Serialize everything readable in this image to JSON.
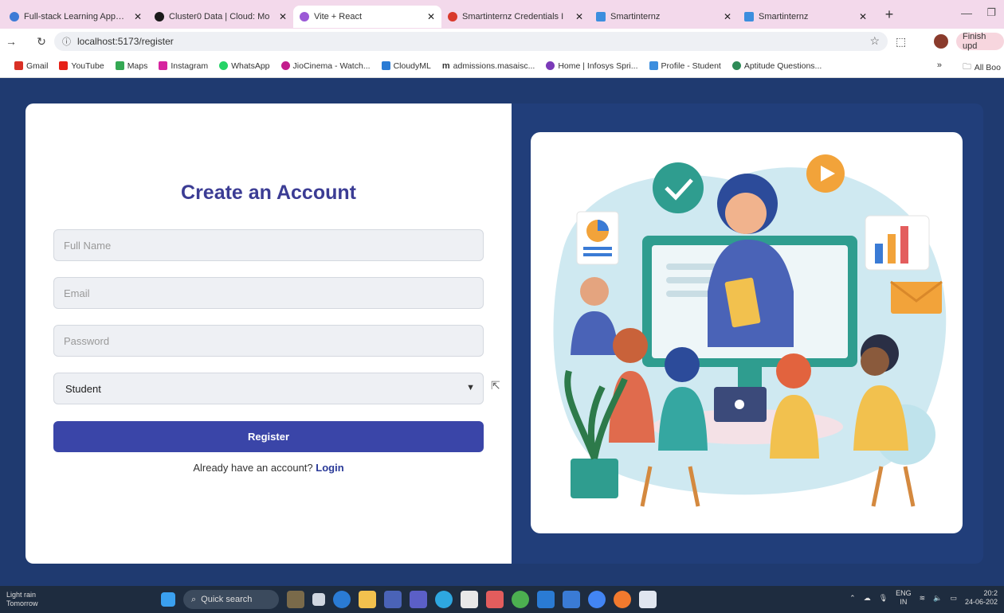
{
  "browser": {
    "tabs": [
      {
        "title": "Full-stack Learning App Sc",
        "color": "#3d7bd6"
      },
      {
        "title": "Cluster0 Data | Cloud: Mo",
        "color": "#1a1a1a"
      },
      {
        "title": "Vite + React",
        "color": "#9b59d6"
      },
      {
        "title": "Smartinternz Credentials I",
        "color": "#d93a2c"
      },
      {
        "title": "Smartinternz",
        "color": "#3c8ede"
      },
      {
        "title": "Smartinternz",
        "color": "#3c8ede"
      }
    ],
    "new_tab": "+",
    "url": "localhost:5173/register",
    "finish_update": "Finish upd",
    "bookmarks": [
      {
        "label": "Gmail",
        "color": "#d93025"
      },
      {
        "label": "YouTube",
        "color": "#e62117"
      },
      {
        "label": "Maps",
        "color": "#34a853"
      },
      {
        "label": "Instagram",
        "color": "#d6249f"
      },
      {
        "label": "WhatsApp",
        "color": "#25d366"
      },
      {
        "label": "JioCinema - Watch...",
        "color": "#c21c8c"
      },
      {
        "label": "CloudyML",
        "color": "#2a7bd4"
      },
      {
        "label": "admissions.masaisc...",
        "color": "#222"
      },
      {
        "label": "Home | Infosys Spri...",
        "color": "#7b3ab8"
      },
      {
        "label": "Profile - Student",
        "color": "#3c8ede"
      },
      {
        "label": "Aptitude Questions...",
        "color": "#2e8b57"
      }
    ],
    "bookmarks_more": "»",
    "all_bookmarks": "All Boo"
  },
  "form": {
    "heading": "Create an Account",
    "fullname_placeholder": "Full Name",
    "email_placeholder": "Email",
    "password_placeholder": "Password",
    "role_selected": "Student",
    "register_label": "Register",
    "login_prompt": "Already have an account?",
    "login_link": "Login"
  },
  "taskbar": {
    "weather_line1": "Light rain",
    "weather_line2": "Tomorrow",
    "search_label": "Quick search",
    "lang_line1": "ENG",
    "lang_line2": "IN",
    "time": "20:2",
    "date": "24-06-202"
  },
  "colors": {
    "page_bg": "#1f3a70",
    "heading": "#3b3c94",
    "button": "#3a45a8"
  }
}
